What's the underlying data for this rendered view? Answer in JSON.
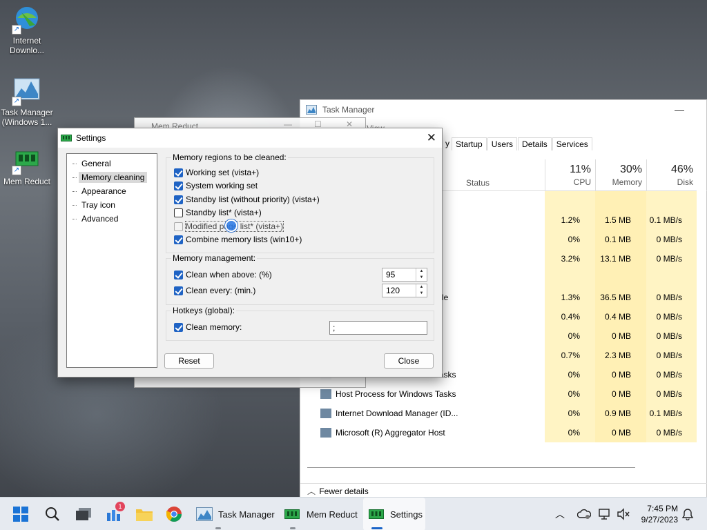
{
  "desktop": {
    "icons": [
      {
        "label": "Internet\nDownlo...",
        "icon": "internet-download-manager-icon"
      },
      {
        "label": "Task Manager\n(Windows 1...",
        "icon": "task-manager-icon"
      },
      {
        "label": "Mem Reduct",
        "icon": "mem-reduct-icon"
      }
    ]
  },
  "task_manager": {
    "title": "Task Manager",
    "tabs": [
      "y",
      "Startup",
      "Users",
      "Details",
      "Services"
    ],
    "columns": {
      "status": "Status",
      "cpu": {
        "pct": "11%",
        "label": "CPU"
      },
      "memory": {
        "pct": "30%",
        "label": "Memory"
      },
      "disk": {
        "pct": "46%",
        "label": "Disk"
      }
    },
    "rows": [
      {
        "name": "",
        "cpu": "",
        "mem": "",
        "disk": ""
      },
      {
        "name": "",
        "cpu": "1.2%",
        "mem": "1.5 MB",
        "disk": "0.1 MB/s"
      },
      {
        "name": "",
        "cpu": "0%",
        "mem": "0.1 MB",
        "disk": "0 MB/s"
      },
      {
        "name": "",
        "cpu": "3.2%",
        "mem": "13.1 MB",
        "disk": "0 MB/s"
      },
      {
        "name": "",
        "cpu": "",
        "mem": "",
        "disk": ""
      },
      {
        "name": "le",
        "cpu": "1.3%",
        "mem": "36.5 MB",
        "disk": "0 MB/s"
      },
      {
        "name": "",
        "cpu": "0.4%",
        "mem": "0.4 MB",
        "disk": "0 MB/s"
      },
      {
        "name": "",
        "cpu": "0%",
        "mem": "0 MB",
        "disk": "0 MB/s"
      },
      {
        "name": "",
        "cpu": "0.7%",
        "mem": "2.3 MB",
        "disk": "0 MB/s"
      },
      {
        "name": "Host Process for Windows Tasks",
        "cpu": "0%",
        "mem": "0 MB",
        "disk": "0 MB/s"
      },
      {
        "name": "Host Process for Windows Tasks",
        "cpu": "0%",
        "mem": "0 MB",
        "disk": "0 MB/s"
      },
      {
        "name": "Internet Download Manager (ID...",
        "cpu": "0%",
        "mem": "0.9 MB",
        "disk": "0.1 MB/s"
      },
      {
        "name": "Microsoft (R) Aggregator Host",
        "cpu": "0%",
        "mem": "0 MB",
        "disk": "0 MB/s"
      }
    ],
    "footer": "Fewer details"
  },
  "mem_reduct": {
    "title": "Mem Reduct",
    "menu_partial": "View"
  },
  "settings": {
    "title": "Settings",
    "nav": [
      "General",
      "Memory cleaning",
      "Appearance",
      "Tray icon",
      "Advanced"
    ],
    "selected_nav": "Memory cleaning",
    "regions": {
      "title": "Memory regions to be cleaned:",
      "items": [
        {
          "label": "Working set (vista+)",
          "checked": true
        },
        {
          "label": "System working set",
          "checked": true
        },
        {
          "label": "Standby list (without priority) (vista+)",
          "checked": true
        },
        {
          "label": "Standby list* (vista+)",
          "checked": false
        },
        {
          "label": "Modified page list* (vista+)",
          "checked": false
        },
        {
          "label": "Combine memory lists (win10+)",
          "checked": true
        }
      ]
    },
    "management": {
      "title": "Memory management:",
      "clean_above_label": "Clean when above: (%)",
      "clean_above_value": "95",
      "clean_every_label": "Clean every: (min.)",
      "clean_every_value": "120"
    },
    "hotkeys": {
      "title": "Hotkeys (global):",
      "clean_memory_label": "Clean memory:",
      "clean_memory_value": ";"
    },
    "buttons": {
      "reset": "Reset",
      "close": "Close"
    }
  },
  "taskbar": {
    "apps": [
      "Task Manager",
      "Mem Reduct",
      "Settings"
    ],
    "badge": "1",
    "time": "7:45 PM",
    "date": "9/27/2023"
  }
}
